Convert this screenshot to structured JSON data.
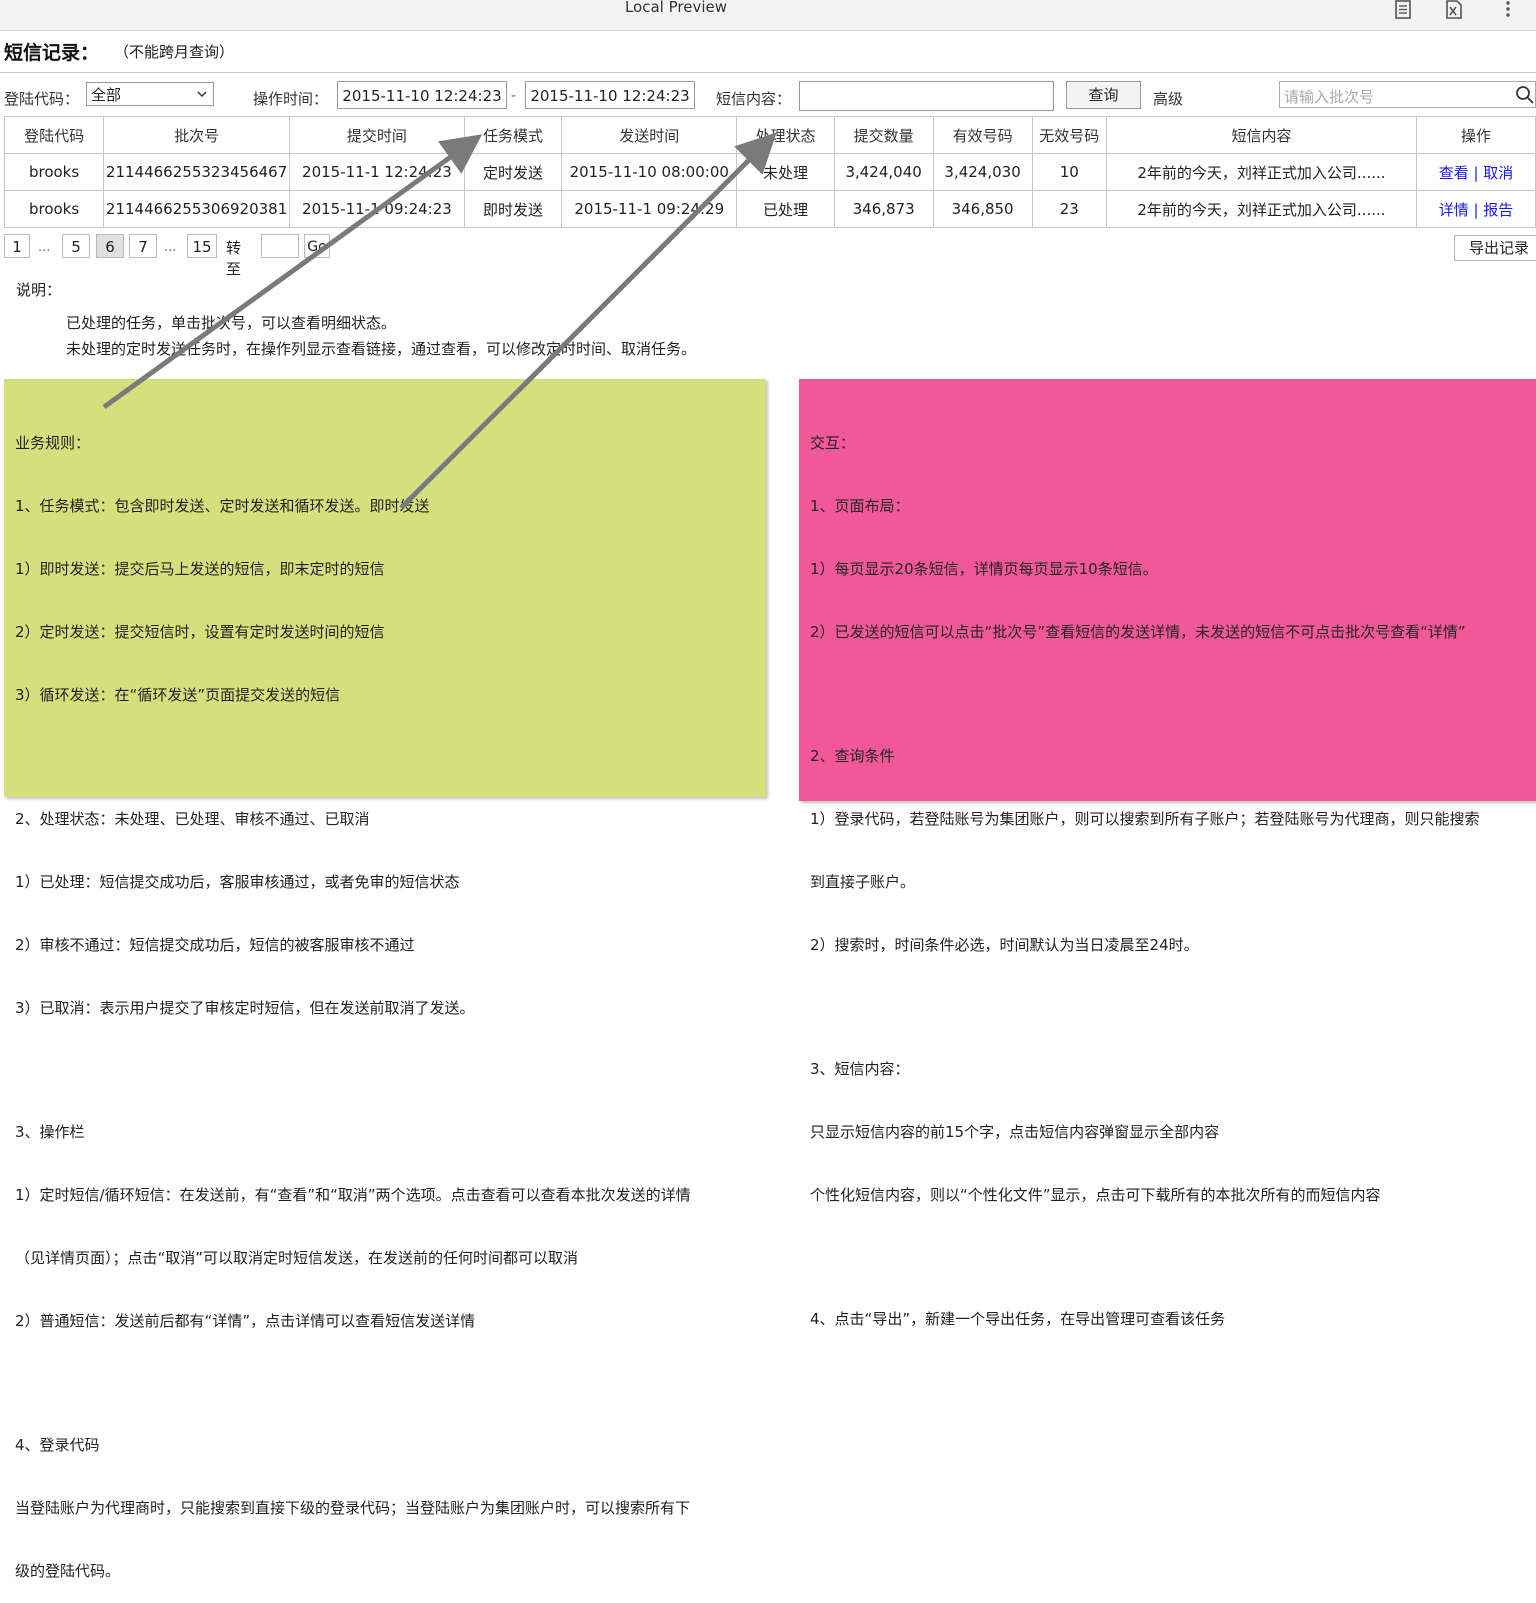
{
  "window": {
    "title": "Local Preview"
  },
  "page": {
    "title": "短信记录：",
    "note": "（不能跨月查询）"
  },
  "filters": {
    "login_label": "登陆代码：",
    "login_value": "全部",
    "time_label": "操作时间：",
    "time_from": "2015-11-10 12:24:23",
    "time_sep": "-",
    "time_to": "2015-11-10 12:24:23",
    "content_label": "短信内容：",
    "content_value": "",
    "query_button": "查询",
    "advanced_label": "高级",
    "batch_placeholder": "请输入批次号"
  },
  "table": {
    "headers": [
      "登陆代码",
      "批次号",
      "提交时间",
      "任务模式",
      "发送时间",
      "处理状态",
      "提交数量",
      "有效号码",
      "无效号码",
      "短信内容",
      "操作"
    ],
    "rows": [
      {
        "login": "brooks",
        "batch": "2114466255323456467",
        "submit_time": "2015-11-1 12:24:23",
        "mode": "定时发送",
        "send_time": "2015-11-10 08:00:00",
        "status": "未处理",
        "submitted": "3,424,040",
        "valid": "3,424,030",
        "invalid": "10",
        "content": "2年前的今天，刘祥正式加入公司......",
        "action1": "查看",
        "sep": " | ",
        "action2": "取消"
      },
      {
        "login": "brooks",
        "batch": "2114466255306920381",
        "submit_time": "2015-11-1 09:24:23",
        "mode": "即时发送",
        "send_time": "2015-11-1 09:24:29",
        "status": "已处理",
        "submitted": "346,873",
        "valid": "346,850",
        "invalid": "23",
        "content": "2年前的今天，刘祥正式加入公司......",
        "action1": "详情",
        "sep": " | ",
        "action2": "报告"
      }
    ]
  },
  "pager": {
    "p1": "1",
    "dots": "...",
    "p5": "5",
    "p6": "6",
    "p7": "7",
    "p15": "15",
    "goto_label": "转至",
    "go_button": "Go",
    "export_button": "导出记录"
  },
  "description": {
    "label": "说明：",
    "lines": [
      "已处理的任务，单击批次号，可以查看明细状态。",
      "未处理的定时发送任务时，在操作列显示查看链接，通过查看，可以修改定时时间、取消任务。"
    ]
  },
  "notes": {
    "green": {
      "color": "#d4e07c",
      "lines": [
        "业务规则：",
        "1、任务模式：包含即时发送、定时发送和循环发送。即时发送",
        "1）即时发送：提交后马上发送的短信，即末定时的短信",
        "2）定时发送：提交短信时，设置有定时发送时间的短信",
        "3）循环发送：在“循环发送”页面提交发送的短信",
        "",
        "2、处理状态：未处理、已处理、审核不通过、已取消",
        "1）已处理：短信提交成功后，客服审核通过，或者免审的短信状态",
        "2）审核不通过：短信提交成功后，短信的被客服审核不通过",
        "3）已取消：表示用户提交了审核定时短信，但在发送前取消了发送。",
        "",
        "3、操作栏",
        "1）定时短信/循环短信：在发送前，有“查看”和“取消”两个选项。点击查看可以查看本批次发送的详情",
        "（见详情页面）；点击“取消”可以取消定时短信发送，在发送前的任何时间都可以取消",
        "2）普通短信：发送前后都有“详情”，点击详情可以查看短信发送详情",
        "",
        "4、登录代码",
        "当登陆账户为代理商时，只能搜索到直接下级的登录代码；当登陆账户为集团账户时，可以搜索所有下",
        "级的登陆代码。"
      ]
    },
    "pink": {
      "color": "#f0589a",
      "lines": [
        "交互：",
        "1、页面布局：",
        "1）每页显示20条短信，详情页每页显示10条短信。",
        "2）已发送的短信可以点击“批次号”查看短信的发送详情，未发送的短信不可点击批次号查看“详情”",
        "",
        "2、查询条件",
        "1）登录代码，若登陆账号为集团账户，则可以搜索到所有子账户；若登陆账号为代理商，则只能搜索",
        "到直接子账户。",
        "2）搜索时，时间条件必选，时间默认为当日凌晨至24时。",
        "",
        "3、短信内容：",
        "只显示短信内容的前15个字，点击短信内容弹窗显示全部内容",
        "个性化短信内容，则以“个性化文件”显示，点击可下载所有的本批次所有的而短信内容",
        "",
        "4、点击“导出”，新建一个导出任务，在导出管理可查看该任务"
      ]
    }
  },
  "icons": {
    "doc": "document-icon",
    "excel": "spreadsheet-icon",
    "more": "more-vert-icon",
    "search": "search-icon",
    "chevron": "chevron-down-icon",
    "arrow": "arrow-annotation"
  }
}
